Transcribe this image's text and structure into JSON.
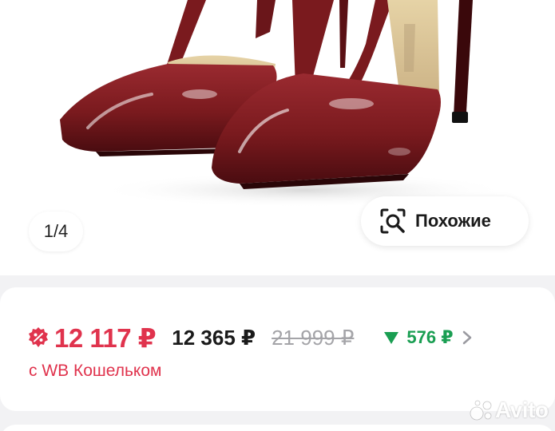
{
  "gallery": {
    "page_counter": "1/4",
    "similar_button": {
      "label": "Похожие",
      "icon": "visual-search-icon"
    },
    "photo": {
      "subject": "burgundy patent leather stiletto heels",
      "color": "#7a1a1e"
    }
  },
  "price": {
    "discount_icon": "percent-badge-icon",
    "wallet_price": "12 117 ₽",
    "regular_price": "12 365 ₽",
    "old_price": "21 999 ₽",
    "price_drop": {
      "amount": "576 ₽",
      "icon": "down-triangle-icon"
    },
    "wallet_note": "с WB Кошельком"
  },
  "watermark": {
    "text": "Avito"
  },
  "colors": {
    "accent_red": "#e0334d",
    "green": "#1a9e52",
    "muted": "#a4a4a8",
    "background": "#f2f2f4"
  }
}
